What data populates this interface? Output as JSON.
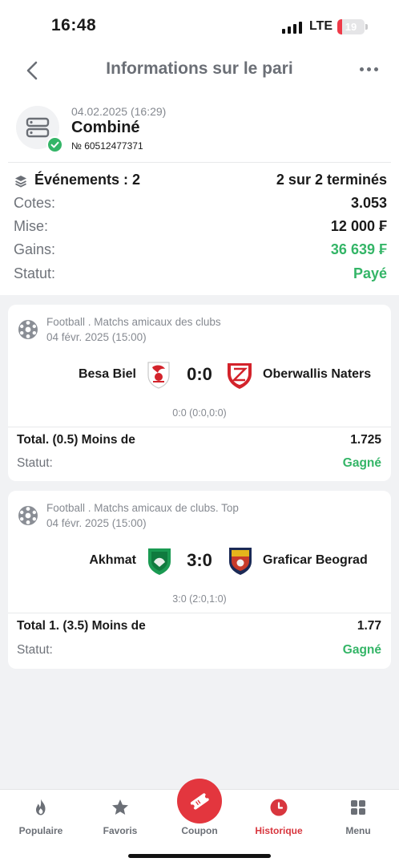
{
  "status_bar": {
    "time": "16:48",
    "network": "LTE",
    "battery": "19",
    "battery_level": 0.19
  },
  "nav": {
    "title": "Informations sur le pari"
  },
  "bet": {
    "date": "04.02.2025 (16:29)",
    "type": "Combiné",
    "number": "№ 60512477371",
    "events_label": "Événements : 2",
    "events_status": "2 sur 2 terminés",
    "odds_label": "Cotes:",
    "odds_value": "3.053",
    "stake_label": "Mise:",
    "stake_value": "12 000 ₣",
    "winnings_label": "Gains:",
    "winnings_value": "36 639 ₣",
    "status_label": "Statut:",
    "status_value": "Payé"
  },
  "events": [
    {
      "league": "Football . Matchs amicaux des clubs",
      "date": "04 févr. 2025 (15:00)",
      "home": "Besa Biel",
      "away": "Oberwallis Naters",
      "score": "0:0",
      "detail_score": "0:0 (0:0,0:0)",
      "pick": "Total. (0.5) Moins de",
      "odd": "1.725",
      "status_label": "Statut:",
      "status_value": "Gagné"
    },
    {
      "league": "Football . Matchs amicaux de clubs. Top",
      "date": "04 févr. 2025 (15:00)",
      "home": "Akhmat",
      "away": "Graficar Beograd",
      "score": "3:0",
      "detail_score": "3:0 (2:0,1:0)",
      "pick": "Total 1. (3.5) Moins de",
      "odd": "1.77",
      "status_label": "Statut:",
      "status_value": "Gagné"
    }
  ],
  "tabs": [
    {
      "label": "Populaire",
      "icon": "fire-icon"
    },
    {
      "label": "Favoris",
      "icon": "star-icon"
    },
    {
      "label": "Coupon",
      "icon": "ticket-icon"
    },
    {
      "label": "Historique",
      "icon": "clock-icon",
      "active": true
    },
    {
      "label": "Menu",
      "icon": "grid-icon"
    }
  ],
  "colors": {
    "accent_red": "#e3363e",
    "win_green": "#34b567",
    "muted": "#6b6f76"
  }
}
